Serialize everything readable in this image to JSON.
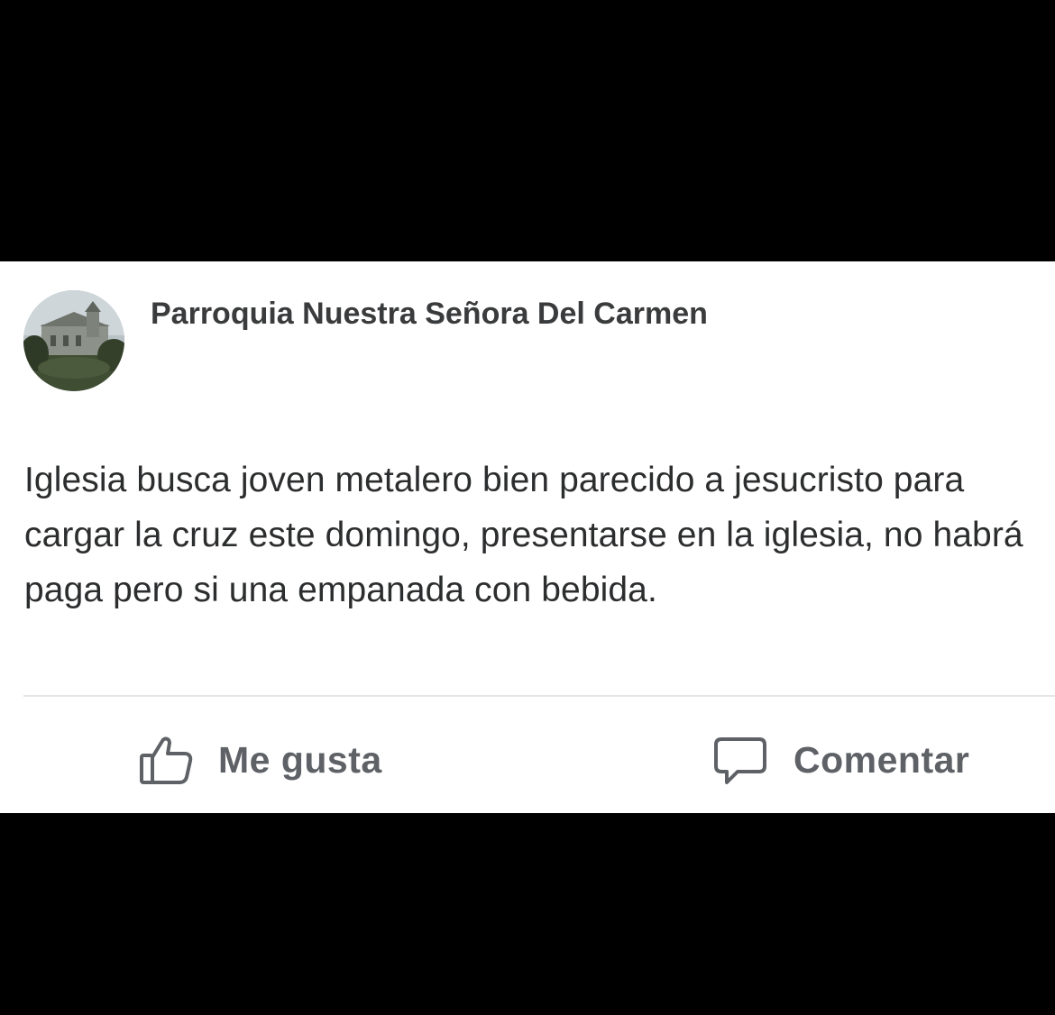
{
  "post": {
    "page_name": "Parroquia Nuestra Señora Del Carmen",
    "avatar_icon": "church-photo-avatar",
    "text": "Iglesia busca joven metalero bien parecido a jesucristo para cargar la cruz este domingo, presentarse en la iglesia, no habrá paga pero si una empanada con bebida."
  },
  "actions": {
    "like": {
      "label": "Me gusta",
      "icon": "thumbs-up-icon"
    },
    "comment": {
      "label": "Comentar",
      "icon": "comment-bubble-icon"
    }
  },
  "colors": {
    "background": "#000000",
    "card": "#ffffff",
    "text": "#2c2d2e",
    "action_text": "#5e6166",
    "divider": "#e4e6e9"
  }
}
